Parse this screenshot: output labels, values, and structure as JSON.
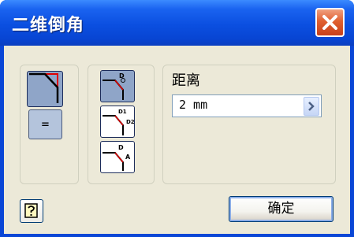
{
  "window": {
    "title": "二维倒角"
  },
  "icons": {
    "close": "close-icon",
    "distance_mode": "chamfer-distance-icon",
    "equal": "equal-sign",
    "method_distance": "chamfer-distance-method-icon",
    "method_two_distances": "chamfer-two-distances-icon",
    "method_distance_angle": "chamfer-distance-angle-icon",
    "help": "help-icon",
    "spin": "chevron-right-icon"
  },
  "mode_buttons": {
    "equal_label": "="
  },
  "distance": {
    "label": "距离",
    "value": "2 mm"
  },
  "method_labels": {
    "d": "D",
    "d1": "D1",
    "d2": "D2",
    "a": "A"
  },
  "footer": {
    "ok_label": "确定"
  },
  "colors": {
    "titlebar": "#0a4fe0",
    "client": "#ece9d8",
    "close": "#e06030",
    "chamfer_line": "#e00000"
  }
}
